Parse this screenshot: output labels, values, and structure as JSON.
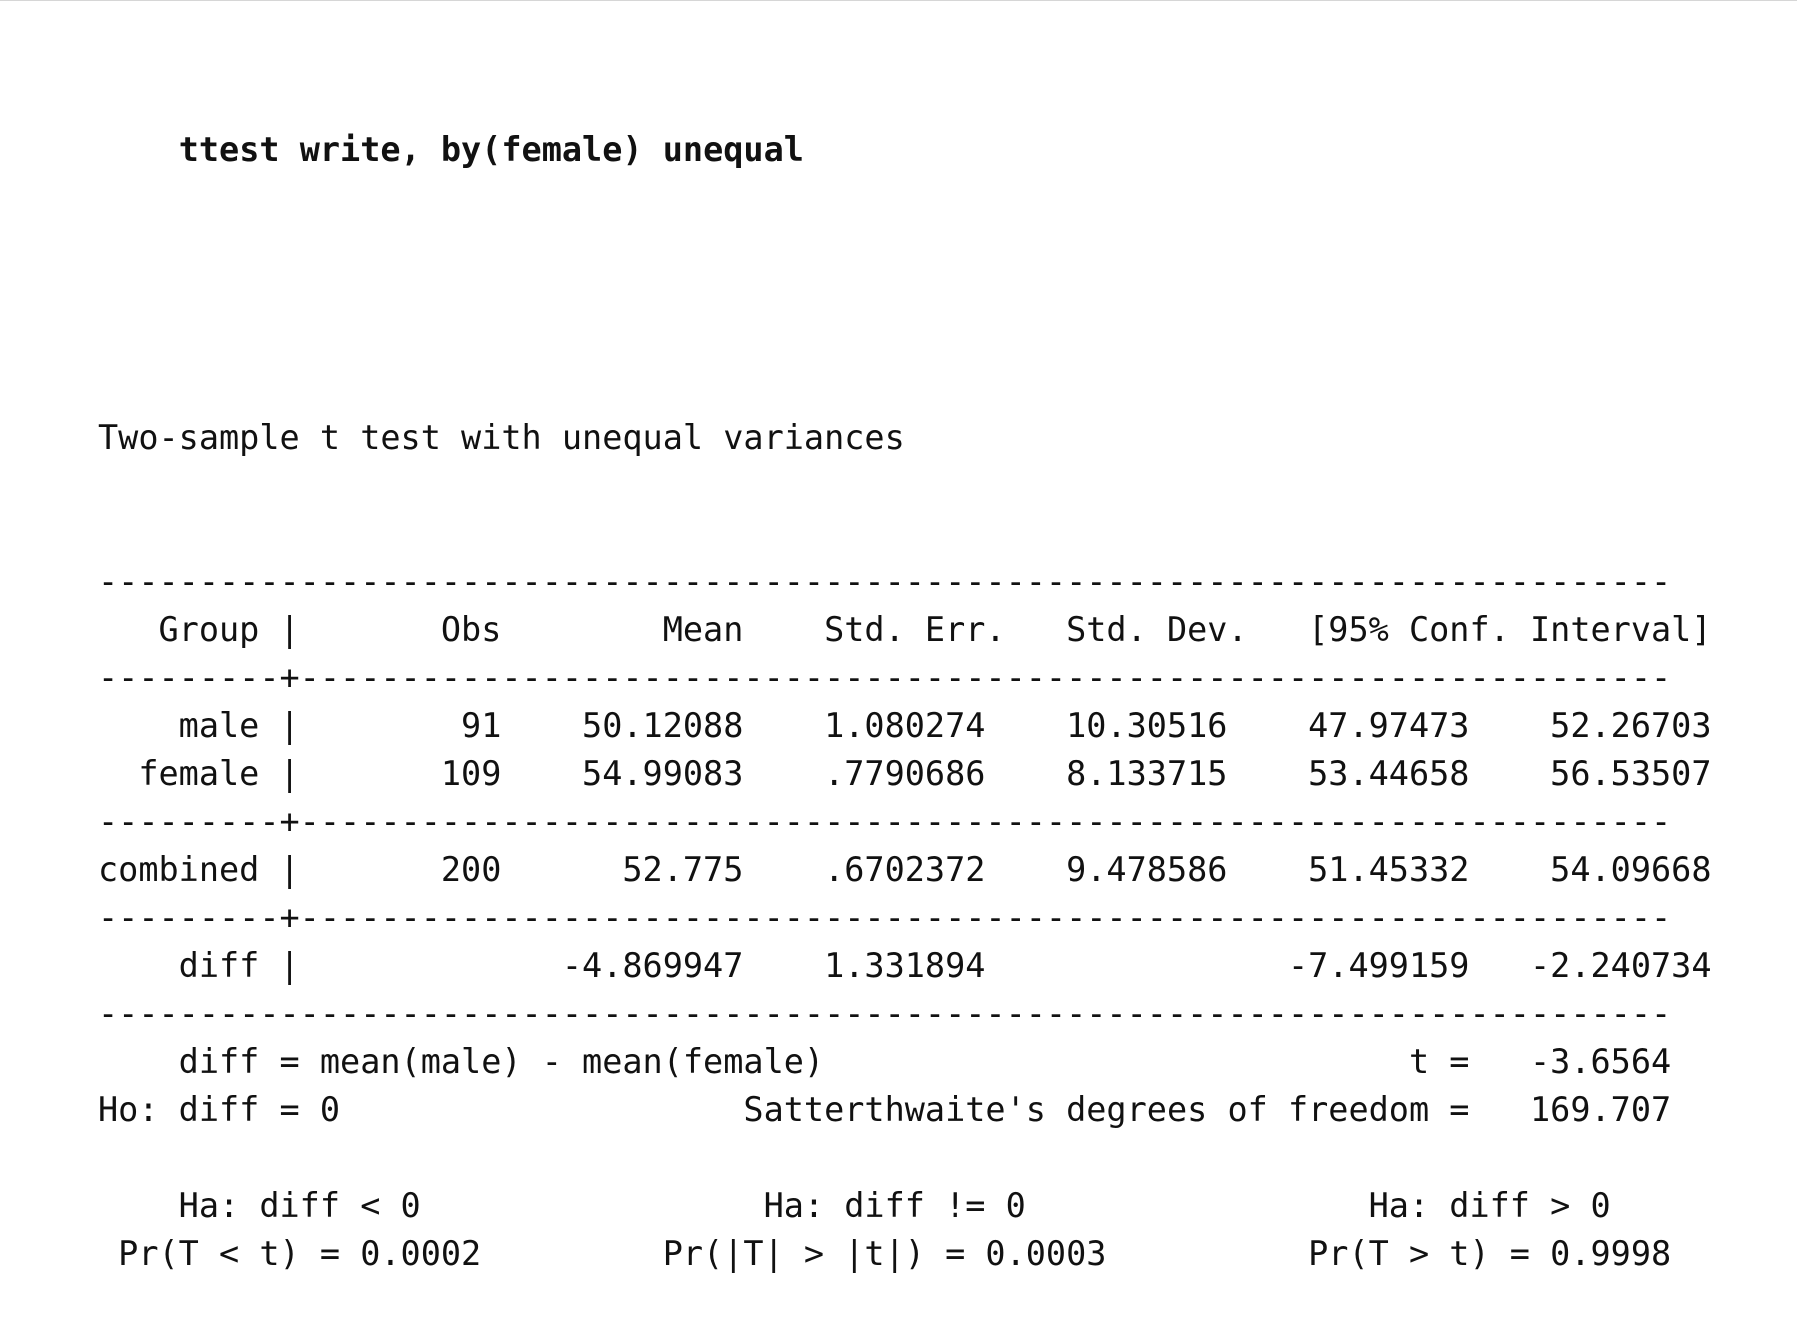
{
  "command": "ttest write, by(female) unequal",
  "title": "Two-sample t test with unequal variances",
  "header": {
    "group": "Group",
    "obs": "Obs",
    "mean": "Mean",
    "se": "Std. Err.",
    "sd": "Std. Dev.",
    "ci": "[95% Conf. Interval]"
  },
  "rows": [
    {
      "group": "male",
      "obs": "91",
      "mean": "50.12088",
      "se": "1.080274",
      "sd": "10.30516",
      "ci_low": "47.97473",
      "ci_high": "52.26703"
    },
    {
      "group": "female",
      "obs": "109",
      "mean": "54.99083",
      "se": ".7790686",
      "sd": "8.133715",
      "ci_low": "53.44658",
      "ci_high": "56.53507"
    }
  ],
  "combined": {
    "group": "combined",
    "obs": "200",
    "mean": "52.775",
    "se": ".6702372",
    "sd": "9.478586",
    "ci_low": "51.45332",
    "ci_high": "54.09668"
  },
  "diff": {
    "group": "diff",
    "mean": "-4.869947",
    "se": "1.331894",
    "ci_low": "-7.499159",
    "ci_high": "-2.240734"
  },
  "stats": {
    "diff_def": "diff = mean(male) - mean(female)",
    "t_label": "t =",
    "t_value": "-3.6564",
    "ho": "Ho: diff = 0",
    "df_label": "Satterthwaite's degrees of freedom =",
    "df_value": "169.707"
  },
  "hypotheses": {
    "ha_lt": "Ha: diff < 0",
    "ha_ne": "Ha: diff != 0",
    "ha_gt": "Ha: diff > 0",
    "p_lt": "Pr(T < t) = 0.0002",
    "p_ne": "Pr(|T| > |t|) = 0.0003",
    "p_gt": "Pr(T > t) = 0.9998"
  }
}
